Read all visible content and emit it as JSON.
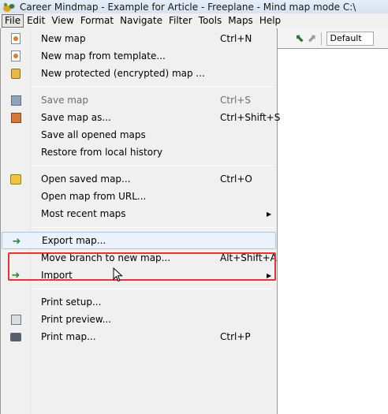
{
  "window": {
    "title": "Career Mindmap - Example for Article - Freeplane - Mind map mode C:\\"
  },
  "menubar": {
    "items": [
      "File",
      "Edit",
      "View",
      "Format",
      "Navigate",
      "Filter",
      "Tools",
      "Maps",
      "Help"
    ],
    "active": "File"
  },
  "toolbar": {
    "style_value": "Default"
  },
  "file_menu": {
    "items": [
      {
        "label": "New map",
        "shortcut": "Ctrl+N",
        "icon": "new-map-icon"
      },
      {
        "label": "New map from template...",
        "shortcut": "",
        "icon": "template-icon"
      },
      {
        "label": "New protected (encrypted) map ...",
        "shortcut": "",
        "icon": "lock-icon"
      },
      {
        "label": "Save map",
        "shortcut": "Ctrl+S",
        "icon": "save-icon",
        "disabled": true
      },
      {
        "label": "Save map as...",
        "shortcut": "Ctrl+Shift+S",
        "icon": "save-as-icon"
      },
      {
        "label": "Save all opened maps",
        "shortcut": ""
      },
      {
        "label": "Restore from local history",
        "shortcut": ""
      },
      {
        "label": "Open saved map...",
        "shortcut": "Ctrl+O",
        "icon": "open-icon"
      },
      {
        "label": "Open map from URL...",
        "shortcut": ""
      },
      {
        "label": "Most recent maps",
        "shortcut": "",
        "submenu": true
      },
      {
        "label": "Export map...",
        "shortcut": "",
        "icon": "export-icon",
        "highlighted": true
      },
      {
        "label": "Move branch to new map...",
        "shortcut": "Alt+Shift+A"
      },
      {
        "label": "Import",
        "shortcut": "",
        "icon": "import-icon",
        "submenu": true
      },
      {
        "label": "Print setup...",
        "shortcut": ""
      },
      {
        "label": "Print preview...",
        "shortcut": "",
        "icon": "print-preview-icon"
      },
      {
        "label": "Print map...",
        "shortcut": "Ctrl+P",
        "icon": "print-icon"
      }
    ]
  },
  "colors": {
    "highlight_border": "#e5343f",
    "hover_bg": "#eaf2fb",
    "menu_bg": "#f0f0f0"
  }
}
